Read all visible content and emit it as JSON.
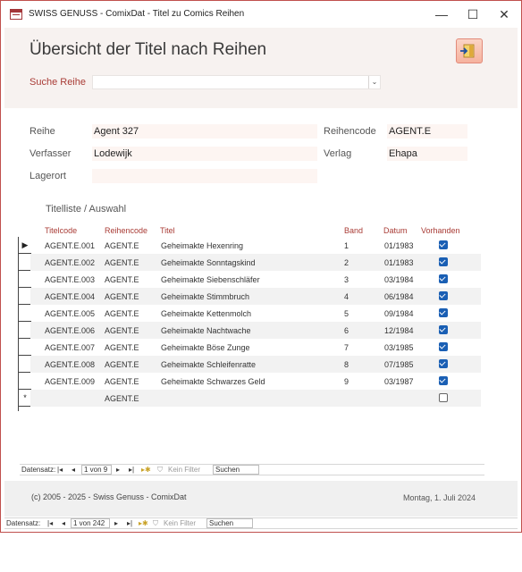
{
  "window": {
    "title": "SWISS GENUSS - ComixDat - Titel zu Comics Reihen",
    "min_glyph": "—",
    "max_glyph": "☐",
    "close_glyph": "✕"
  },
  "header": {
    "title": "Übersicht der Titel nach Reihen",
    "exit_icon": "exit-door-icon",
    "search_label": "Suche Reihe",
    "search_value": "",
    "combo_arrow": "⌄"
  },
  "fields": {
    "reihe_label": "Reihe",
    "reihe_value": "Agent 327",
    "reihencode_label": "Reihencode",
    "reihencode_value": "AGENT.E",
    "verfasser_label": "Verfasser",
    "verfasser_value": "Lodewijk",
    "verlag_label": "Verlag",
    "verlag_value": "Ehapa",
    "lagerort_label": "Lagerort",
    "lagerort_value": ""
  },
  "subform": {
    "section_label": "Titelliste / Auswahl",
    "columns": {
      "titelcode": "Titelcode",
      "reihencode": "Reihencode",
      "titel": "Titel",
      "band": "Band",
      "datum": "Datum",
      "vorhanden": "Vorhanden"
    },
    "rows": [
      {
        "titelcode": "AGENT.E.001",
        "reihencode": "AGENT.E",
        "titel": "Geheimakte Hexenring",
        "band": "1",
        "datum": "01/1983",
        "vorhanden": true
      },
      {
        "titelcode": "AGENT.E.002",
        "reihencode": "AGENT.E",
        "titel": "Geheimakte Sonntagskind",
        "band": "2",
        "datum": "01/1983",
        "vorhanden": true
      },
      {
        "titelcode": "AGENT.E.003",
        "reihencode": "AGENT.E",
        "titel": "Geheimakte Siebenschläfer",
        "band": "3",
        "datum": "03/1984",
        "vorhanden": true
      },
      {
        "titelcode": "AGENT.E.004",
        "reihencode": "AGENT.E",
        "titel": "Geheimakte Stimmbruch",
        "band": "4",
        "datum": "06/1984",
        "vorhanden": true
      },
      {
        "titelcode": "AGENT.E.005",
        "reihencode": "AGENT.E",
        "titel": "Geheimakte Kettenmolch",
        "band": "5",
        "datum": "09/1984",
        "vorhanden": true
      },
      {
        "titelcode": "AGENT.E.006",
        "reihencode": "AGENT.E",
        "titel": "Geheimakte Nachtwache",
        "band": "6",
        "datum": "12/1984",
        "vorhanden": true
      },
      {
        "titelcode": "AGENT.E.007",
        "reihencode": "AGENT.E",
        "titel": "Geheimakte Böse Zunge",
        "band": "7",
        "datum": "03/1985",
        "vorhanden": true
      },
      {
        "titelcode": "AGENT.E.008",
        "reihencode": "AGENT.E",
        "titel": "Geheimakte Schleifenratte",
        "band": "8",
        "datum": "07/1985",
        "vorhanden": true
      },
      {
        "titelcode": "AGENT.E.009",
        "reihencode": "AGENT.E",
        "titel": "Geheimakte Schwarzes Geld",
        "band": "9",
        "datum": "03/1987",
        "vorhanden": true
      }
    ],
    "new_row": {
      "reihencode": "AGENT.E",
      "vorhanden": false
    },
    "current_row_marker": "▶",
    "new_row_marker": "*",
    "nav": {
      "label": "Datensatz:",
      "first": "|◂",
      "prev": "◂",
      "record": "1 von 9",
      "next": "▸",
      "last": "▸|",
      "new": "▸✱",
      "filter": "Kein Filter",
      "search": "Suchen"
    }
  },
  "footer": {
    "copyright": "(c) 2005 - 2025 - Swiss Genuss - ComixDat",
    "date": "Montag, 1. Juli 2024"
  },
  "main_nav": {
    "label": "Datensatz:",
    "first": "|◂",
    "prev": "◂",
    "record": "1 von 242",
    "next": "▸",
    "last": "▸|",
    "new": "▸✱",
    "filter": "Kein Filter",
    "search": "Suchen"
  },
  "colors": {
    "accent": "#a93c36",
    "header_bg": "#f7f2f0",
    "field_bg": "#fdf5f2",
    "checkbox": "#1a5fb4",
    "exit_button": "#f6b29e"
  }
}
